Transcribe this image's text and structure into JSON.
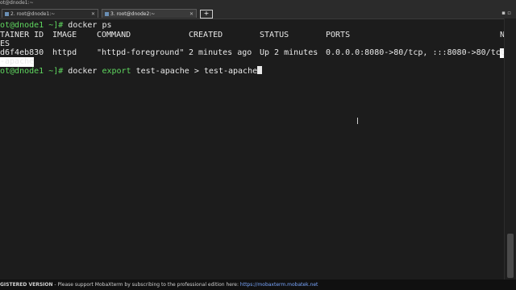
{
  "window": {
    "title_fragment": "ot@dnode1:~",
    "tabs": [
      {
        "label": "2. root@dnode1:~"
      },
      {
        "label": "3. root@dnode2:~"
      }
    ],
    "new_tab_label": "+",
    "corner_label": "N"
  },
  "terminal": {
    "line1_prompt": "ot@dnode1 ~]# ",
    "line1_cmd": "docker ps",
    "headers": [
      "TAINER ID",
      "IMAGE",
      "COMMAND",
      "CREATED",
      "STATUS",
      "PORTS"
    ],
    "header_wrap": "ES",
    "row": {
      "id": "d6f4eb830",
      "image": "httpd",
      "command": "\"httpd-foreground\"",
      "created": "2 minutes ago",
      "status": "Up 2 minutes",
      "ports": "0.0.0.0:8080->80/tcp, :::8080->80/tcp",
      "trail_char": "t"
    },
    "row_wrap": "-apache",
    "line_last_prompt": "ot@dnode1 ~]# ",
    "line_last_cmd_1": "docker ",
    "line_last_cmd_keyword": "export",
    "line_last_cmd_2": " test-apache > test-apache"
  },
  "status_bar": {
    "lead": "GISTERED VERSION",
    "text": " - Please support MobaXterm by subscribing to the professional edition here: ",
    "link": "https://mobaxterm.mobatek.net"
  },
  "colors": {
    "prompt_green": "#5fd75f",
    "background": "#1c1c1c"
  }
}
